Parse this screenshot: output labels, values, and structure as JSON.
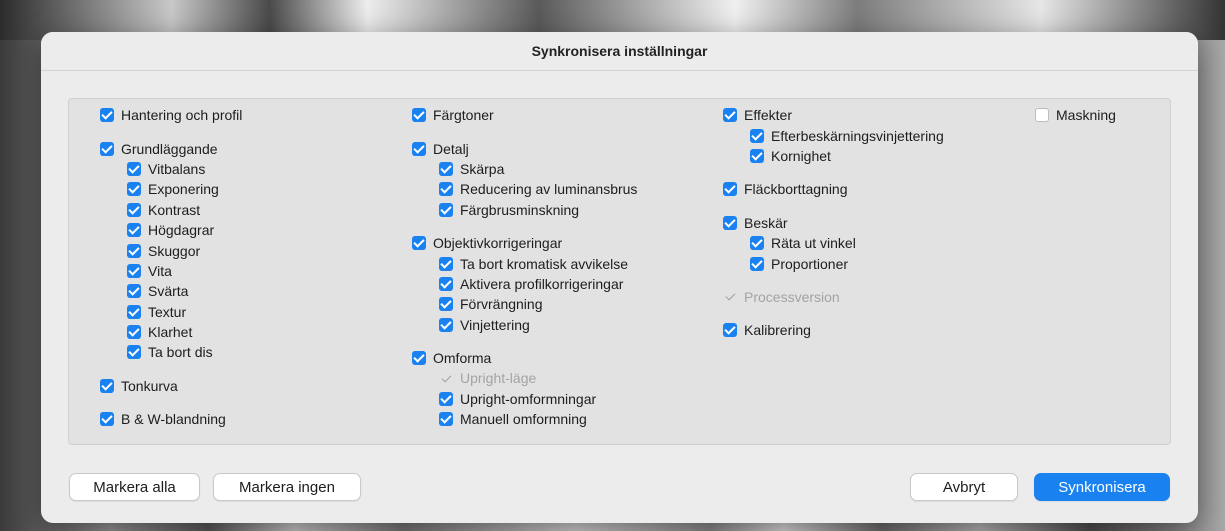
{
  "dialog": {
    "title": "Synkronisera inställningar",
    "accent_color": "#1a82f0"
  },
  "columns": [
    [
      {
        "label": "Hantering och profil",
        "checked": true
      },
      {
        "gap": true
      },
      {
        "label": "Grundläggande",
        "checked": true
      },
      {
        "label": "Vitbalans",
        "checked": true,
        "sub": true
      },
      {
        "label": "Exponering",
        "checked": true,
        "sub": true
      },
      {
        "label": "Kontrast",
        "checked": true,
        "sub": true
      },
      {
        "label": "Högdagrar",
        "checked": true,
        "sub": true
      },
      {
        "label": "Skuggor",
        "checked": true,
        "sub": true
      },
      {
        "label": "Vita",
        "checked": true,
        "sub": true
      },
      {
        "label": "Svärta",
        "checked": true,
        "sub": true
      },
      {
        "label": "Textur",
        "checked": true,
        "sub": true
      },
      {
        "label": "Klarhet",
        "checked": true,
        "sub": true
      },
      {
        "label": "Ta bort dis",
        "checked": true,
        "sub": true
      },
      {
        "gap": true
      },
      {
        "label": "Tonkurva",
        "checked": true
      },
      {
        "gap": true
      },
      {
        "label": "B & W-blandning",
        "checked": true
      }
    ],
    [
      {
        "label": "Färgtoner",
        "checked": true
      },
      {
        "gap": true
      },
      {
        "label": "Detalj",
        "checked": true
      },
      {
        "label": "Skärpa",
        "checked": true,
        "sub": true
      },
      {
        "label": "Reducering av luminansbrus",
        "checked": true,
        "sub": true
      },
      {
        "label": "Färgbrusminskning",
        "checked": true,
        "sub": true
      },
      {
        "gap": true
      },
      {
        "label": "Objektivkorrigeringar",
        "checked": true
      },
      {
        "label": "Ta bort kromatisk avvikelse",
        "checked": true,
        "sub": true
      },
      {
        "label": "Aktivera profilkorrigeringar",
        "checked": true,
        "sub": true
      },
      {
        "label": "Förvrängning",
        "checked": true,
        "sub": true
      },
      {
        "label": "Vinjettering",
        "checked": true,
        "sub": true
      },
      {
        "gap": true
      },
      {
        "label": "Omforma",
        "checked": true
      },
      {
        "label": "Upright-läge",
        "checked": true,
        "sub": true,
        "disabled": true
      },
      {
        "label": "Upright-omformningar",
        "checked": true,
        "sub": true
      },
      {
        "label": "Manuell omformning",
        "checked": true,
        "sub": true
      }
    ],
    [
      {
        "label": "Effekter",
        "checked": true
      },
      {
        "label": "Efterbeskärningsvinjettering",
        "checked": true,
        "sub": true
      },
      {
        "label": "Kornighet",
        "checked": true,
        "sub": true
      },
      {
        "gap": true
      },
      {
        "label": "Fläckborttagning",
        "checked": true
      },
      {
        "gap": true
      },
      {
        "label": "Beskär",
        "checked": true
      },
      {
        "label": "Räta ut vinkel",
        "checked": true,
        "sub": true
      },
      {
        "label": "Proportioner",
        "checked": true,
        "sub": true
      },
      {
        "gap": true
      },
      {
        "label": "Processversion",
        "checked": true,
        "disabled": true
      },
      {
        "gap": true
      },
      {
        "label": "Kalibrering",
        "checked": true
      }
    ],
    [
      {
        "label": "Maskning",
        "checked": false
      }
    ]
  ],
  "buttons": {
    "select_all": "Markera alla",
    "select_none": "Markera ingen",
    "cancel": "Avbryt",
    "synchronize": "Synkronisera"
  }
}
